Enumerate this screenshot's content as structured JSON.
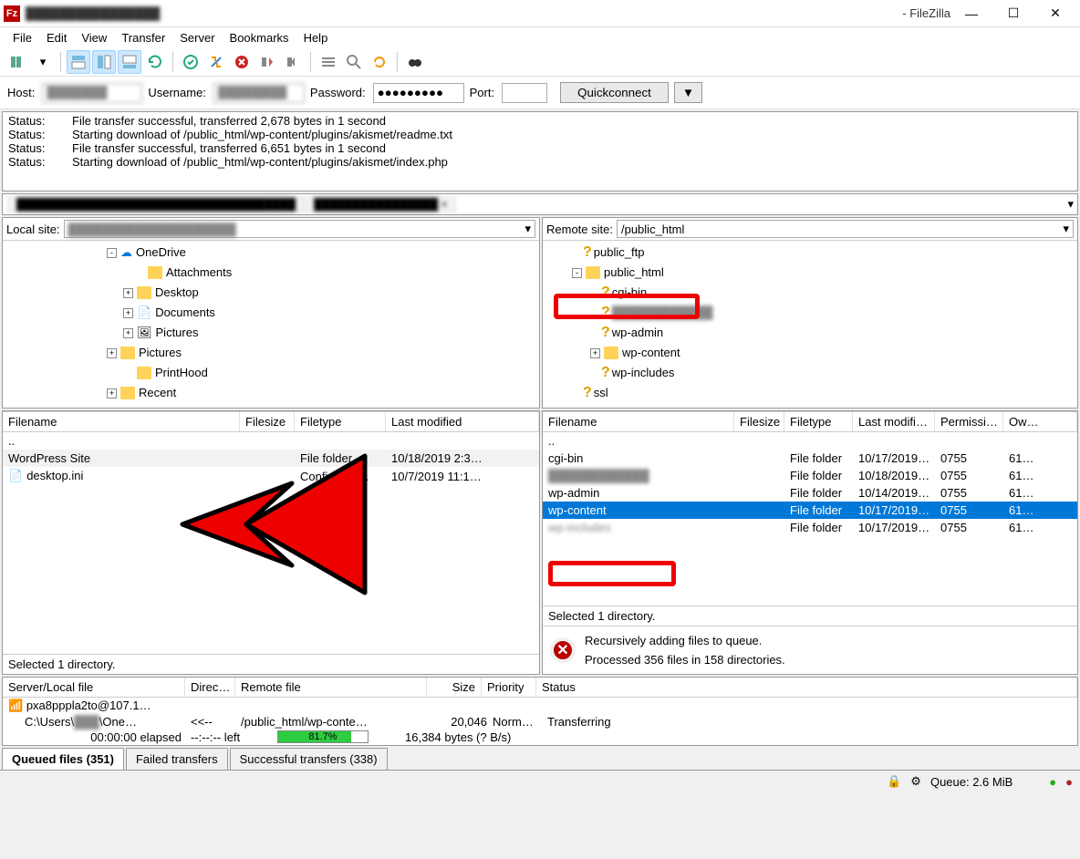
{
  "title_suffix": "- FileZilla",
  "menus": [
    "File",
    "Edit",
    "View",
    "Transfer",
    "Server",
    "Bookmarks",
    "Help"
  ],
  "conn": {
    "host_label": "Host:",
    "username_label": "Username:",
    "password_label": "Password:",
    "password_value": "●●●●●●●●●",
    "port_label": "Port:",
    "quickconnect": "Quickconnect"
  },
  "logs": [
    {
      "label": "Status:",
      "msg": "File transfer successful, transferred 2,678 bytes in 1 second"
    },
    {
      "label": "Status:",
      "msg": "Starting download of /public_html/wp-content/plugins/akismet/readme.txt"
    },
    {
      "label": "Status:",
      "msg": "File transfer successful, transferred 6,651 bytes in 1 second"
    },
    {
      "label": "Status:",
      "msg": "Starting download of /public_html/wp-content/plugins/akismet/index.php"
    }
  ],
  "local": {
    "label": "Local site:",
    "tree": [
      {
        "indent": 110,
        "exp": "-",
        "icon": "cloud",
        "name": "OneDrive"
      },
      {
        "indent": 140,
        "exp": "",
        "icon": "folder",
        "name": "Attachments"
      },
      {
        "indent": 128,
        "exp": "+",
        "icon": "folder",
        "name": "Desktop"
      },
      {
        "indent": 128,
        "exp": "+",
        "icon": "doc",
        "name": "Documents"
      },
      {
        "indent": 128,
        "exp": "+",
        "icon": "pic",
        "name": "Pictures"
      },
      {
        "indent": 110,
        "exp": "+",
        "icon": "folder",
        "name": "Pictures"
      },
      {
        "indent": 128,
        "exp": "",
        "icon": "folder",
        "name": "PrintHood"
      },
      {
        "indent": 110,
        "exp": "+",
        "icon": "folder",
        "name": "Recent"
      }
    ],
    "cols": [
      "Filename",
      "Filesize",
      "Filetype",
      "Last modified"
    ],
    "rows": [
      {
        "name": "..",
        "type": "",
        "mod": "",
        "sel": false
      },
      {
        "name": "WordPress Site",
        "type": "File folder",
        "mod": "10/18/2019 2:3…",
        "sel": true
      },
      {
        "name": "desktop.ini",
        "type": "Configurati…",
        "mod": "10/7/2019 11:1…",
        "sel": false
      }
    ],
    "status": "Selected 1 directory."
  },
  "remote": {
    "label": "Remote site:",
    "path": "/public_html",
    "tree": [
      {
        "indent": 20,
        "exp": "",
        "q": true,
        "name": "public_ftp",
        "blur": false
      },
      {
        "indent": 8,
        "exp": "-",
        "q": false,
        "name": "public_html",
        "blur": false,
        "highlight": true
      },
      {
        "indent": 40,
        "exp": "",
        "q": true,
        "name": "cgi-bin",
        "blur": false
      },
      {
        "indent": 40,
        "exp": "",
        "q": true,
        "name": "████████████",
        "blur": true
      },
      {
        "indent": 40,
        "exp": "",
        "q": true,
        "name": "wp-admin",
        "blur": false
      },
      {
        "indent": 28,
        "exp": "+",
        "q": false,
        "name": "wp-content",
        "blur": false
      },
      {
        "indent": 40,
        "exp": "",
        "q": true,
        "name": "wp-includes",
        "blur": false
      },
      {
        "indent": 20,
        "exp": "",
        "q": true,
        "name": "ssl",
        "blur": false
      }
    ],
    "cols": [
      "Filename",
      "Filesize",
      "Filetype",
      "Last modifi…",
      "Permissi…",
      "Ow…"
    ],
    "rows": [
      {
        "name": "..",
        "type": "",
        "mod": "",
        "perm": "",
        "own": ""
      },
      {
        "name": "cgi-bin",
        "type": "File folder",
        "mod": "10/17/2019…",
        "perm": "0755",
        "own": "61…"
      },
      {
        "name": "████████████",
        "type": "File folder",
        "mod": "10/18/2019…",
        "perm": "0755",
        "own": "61…",
        "blur": true
      },
      {
        "name": "wp-admin",
        "type": "File folder",
        "mod": "10/14/2019…",
        "perm": "0755",
        "own": "61…"
      },
      {
        "name": "wp-content",
        "type": "File folder",
        "mod": "10/17/2019…",
        "perm": "0755",
        "own": "61…",
        "blue": true,
        "highlight": true
      },
      {
        "name": "wp-includes",
        "type": "File folder",
        "mod": "10/17/2019…",
        "perm": "0755",
        "own": "61…",
        "blur": true
      }
    ],
    "status": "Selected 1 directory.",
    "info_line1": "Recursively adding files to queue.",
    "info_line2": "Processed 356 files in 158 directories."
  },
  "transfer": {
    "cols": [
      "Server/Local file",
      "Direc…",
      "Remote file",
      "Size",
      "Priority",
      "Status"
    ],
    "row1_server": "pxa8pppla2to@107.1…",
    "row2_local": "C:\\Users\\████\\One…",
    "row2_dir": "<<--",
    "row2_remote": "/public_html/wp-conte…",
    "row2_size": "20,046",
    "row2_prio": "Norm…",
    "row2_status": "Transferring",
    "row3_elapsed": "00:00:00 elapsed",
    "row3_left": "--:--:-- left",
    "row3_pct": "81.7%",
    "row3_bytes": "16,384 bytes (? B/s)"
  },
  "bottom_tabs": [
    "Queued files (351)",
    "Failed transfers",
    "Successful transfers (338)"
  ],
  "queue": "Queue: 2.6 MiB"
}
